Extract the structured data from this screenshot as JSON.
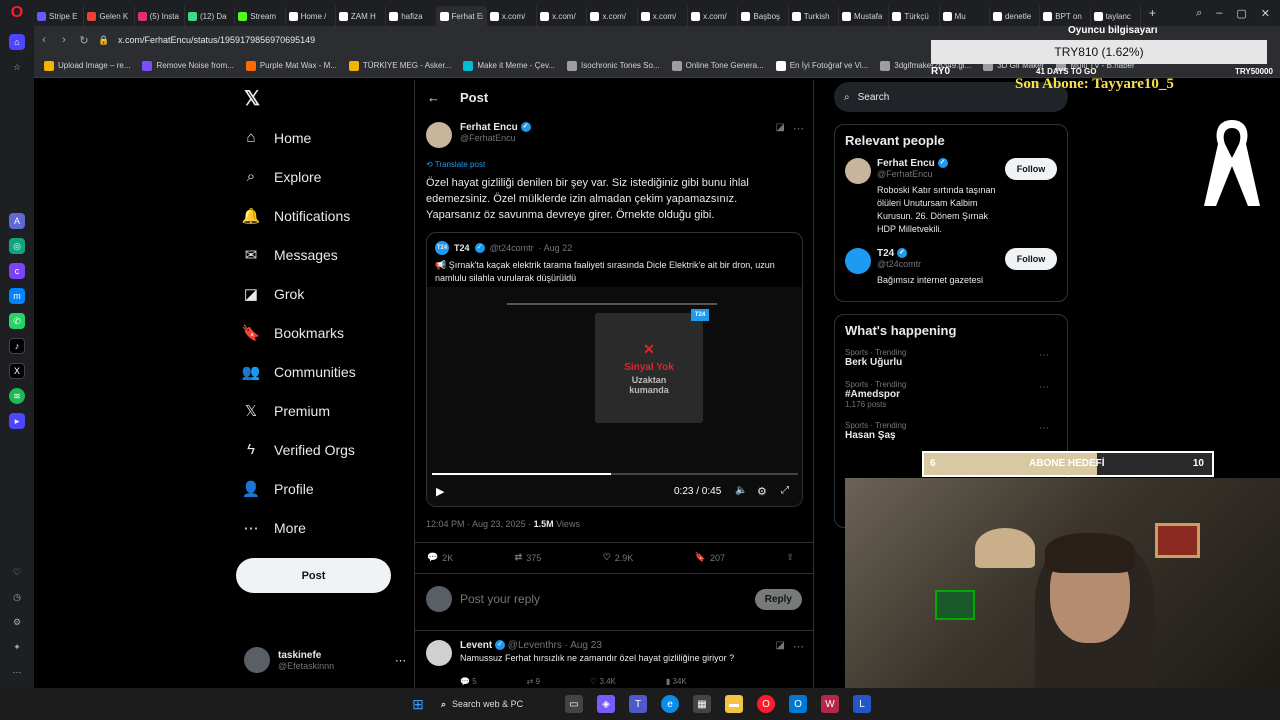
{
  "browser": {
    "tabs": [
      {
        "label": "Stripe E",
        "color": "#635bff"
      },
      {
        "label": "Gelen K",
        "color": "#ea4335"
      },
      {
        "label": "(5) Insta",
        "color": "#e1306c"
      },
      {
        "label": "(12) Da",
        "color": "#3ddc84"
      },
      {
        "label": "Stream",
        "color": "#53fc18"
      },
      {
        "label": "Home /",
        "color": "#ffffff"
      },
      {
        "label": "ZAM H",
        "color": "#ffffff"
      },
      {
        "label": "hafiza",
        "color": "#ffffff"
      },
      {
        "label": "Ferhat Encu",
        "color": "#ffffff",
        "active": true
      },
      {
        "label": "x.com/",
        "color": "#ffffff"
      },
      {
        "label": "x.com/",
        "color": "#ffffff"
      },
      {
        "label": "x.com/",
        "color": "#ffffff"
      },
      {
        "label": "x.com/",
        "color": "#ffffff"
      },
      {
        "label": "x.com/",
        "color": "#ffffff"
      },
      {
        "label": "Başboş",
        "color": "#ffffff"
      },
      {
        "label": "Turkish",
        "color": "#ffffff"
      },
      {
        "label": "Mustafa",
        "color": "#ffffff"
      },
      {
        "label": "Türkçü",
        "color": "#ffffff"
      },
      {
        "label": "Mu",
        "color": "#ffffff"
      },
      {
        "label": "denetle",
        "color": "#ffffff"
      },
      {
        "label": "BPT on",
        "color": "#ffffff"
      },
      {
        "label": "taylanc",
        "color": "#ffffff"
      }
    ],
    "url": "x.com/FerhatEncu/status/1959179856970695149",
    "bookmarks": [
      {
        "label": "Upload Image – re...",
        "color": "#f4b400"
      },
      {
        "label": "Remove Noise from...",
        "color": "#7c4dff"
      },
      {
        "label": "Purple Mat Wax - M...",
        "color": "#ff6d00"
      },
      {
        "label": "TÜRKİYE MEG - Asker...",
        "color": "#f4b400"
      },
      {
        "label": "Make it Meme - Çev...",
        "color": "#00bcd4"
      },
      {
        "label": "Isochronic Tones So...",
        "color": "#9e9e9e"
      },
      {
        "label": "Online Tone Genera...",
        "color": "#9e9e9e"
      },
      {
        "label": "En İyi Fotoğraf ve Vi...",
        "color": "#ffffff"
      },
      {
        "label": "3dgifmaker28349.gi...",
        "color": "#9e9e9e"
      },
      {
        "label": "3D Gif Maker",
        "color": "#9e9e9e"
      },
      {
        "label": "Multi TV - B.haber",
        "color": "#9e9e9e"
      }
    ]
  },
  "nav": {
    "items": [
      {
        "id": "home",
        "label": "Home",
        "icon": "⌂"
      },
      {
        "id": "explore",
        "label": "Explore",
        "icon": "⌕"
      },
      {
        "id": "notifications",
        "label": "Notifications",
        "icon": "🔔"
      },
      {
        "id": "messages",
        "label": "Messages",
        "icon": "✉"
      },
      {
        "id": "grok",
        "label": "Grok",
        "icon": "◪"
      },
      {
        "id": "bookmarks",
        "label": "Bookmarks",
        "icon": "🔖"
      },
      {
        "id": "communities",
        "label": "Communities",
        "icon": "👥"
      },
      {
        "id": "premium",
        "label": "Premium",
        "icon": "𝕏"
      },
      {
        "id": "verified",
        "label": "Verified Orgs",
        "icon": "ϟ"
      },
      {
        "id": "profile",
        "label": "Profile",
        "icon": "👤"
      },
      {
        "id": "more",
        "label": "More",
        "icon": "⋯"
      }
    ],
    "post_label": "Post",
    "account_name": "taskinefe",
    "account_handle": "@Efetaskinnn"
  },
  "main": {
    "header_title": "Post",
    "author_name": "Ferhat Encu",
    "author_handle": "@FerhatEncu",
    "translate": "Translate post",
    "text": "Özel hayat gizliliği denilen bir şey var. Siz istediğiniz gibi bunu ihlal edemezsiniz. Özel mülklerde izin almadan çekim yapamazsınız. Yaparsanız öz savunma devreye girer. Örnekte olduğu gibi.",
    "quote": {
      "name": "T24",
      "handle": "@t24comtr",
      "date": "· Aug 22",
      "text": "📢 Şırnak'ta kaçak elektrik tarama faaliyeti sırasında Dicle Elektrik'e ait bir dron, uzun namlulu silahla vurularak düşürüldü",
      "badge": "T24",
      "signal_line1": "Sinyal Yok",
      "signal_line2": "Uzaktan",
      "signal_line3": "kumanda",
      "time": "0:23 / 0:45",
      "progress": 0.49
    },
    "meta_time": "12:04 PM · Aug 23, 2025 · ",
    "meta_views": "1.5M",
    "meta_views_label": " Views",
    "replies": "2K",
    "retweets": "375",
    "likes": "2.9K",
    "bookmarks": "207",
    "reply_placeholder": "Post your reply",
    "reply_button": "Reply",
    "reply": {
      "name": "Levent",
      "handle": "@Leventhrs · Aug 23",
      "text": "Namussuz Ferhat hırsızlık ne zamandır özel hayat gizliliğine giriyor ?",
      "replies": "5",
      "retweets": "9",
      "likes": "3.4K",
      "views": "34K"
    }
  },
  "sidebar": {
    "search_placeholder": "Search",
    "relevant_title": "Relevant people",
    "people": [
      {
        "name": "Ferhat Encu",
        "handle": "@FerhatEncu",
        "bio": "Roboski Katır sırtında taşınan ölüleri Unutursam Kalbim Kurusun. 26. Dönem Şırnak HDP Milletvekili.",
        "follow": "Follow"
      },
      {
        "name": "T24",
        "handle": "@t24comtr",
        "bio": "Bağımsız internet gazetesi",
        "follow": "Follow"
      }
    ],
    "happening_title": "What's happening",
    "trends": [
      {
        "cat": "Sports · Trending",
        "name": "Berk Uğurlu",
        "posts": ""
      },
      {
        "cat": "Sports · Trending",
        "name": "#Amedspor",
        "posts": "1,176 posts"
      },
      {
        "cat": "Sports · Trending",
        "name": "Hasan Şaş",
        "posts": ""
      }
    ]
  },
  "overlay": {
    "top_label": "Oyuncu bilgisayarı",
    "currency": "TRY810 (1.62%)",
    "left_val": "RY0",
    "days": "41 DAYS TO GO",
    "right_val": "TRY50000",
    "son_abone": "Son Abone: Tayyare10_5",
    "goal_left": "6",
    "goal_label": "ABONE HEDEFİ",
    "goal_right": "10",
    "goal_progress": 0.6
  },
  "taskbar": {
    "search": "Search web & PC"
  },
  "colors": {
    "accent": "#1d9bf0",
    "overlay_gold": "#f5e04a"
  }
}
